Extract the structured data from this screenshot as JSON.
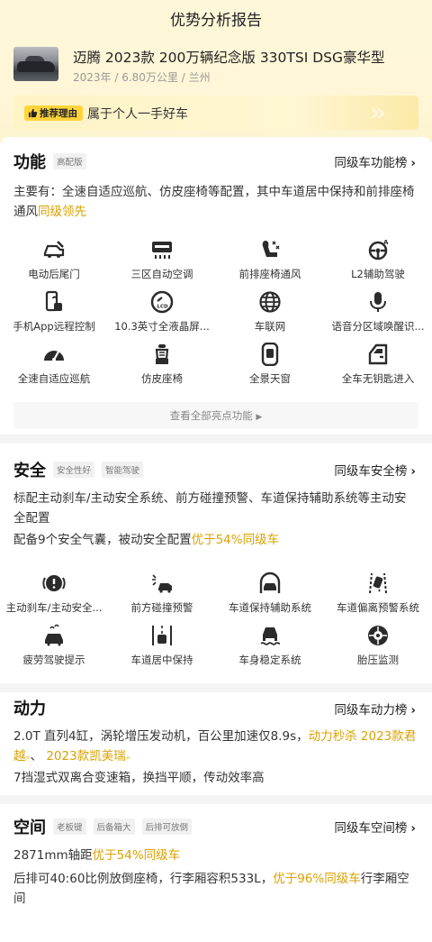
{
  "page_title": "优势分析报告",
  "car": {
    "title": "迈腾 2023款 200万辆纪念版 330TSI DSG豪华型",
    "meta": "2023年 / 6.80万公里 / 兰州"
  },
  "reason": {
    "tag": "推荐理由",
    "text": "属于个人一手好车"
  },
  "function": {
    "title": "功能",
    "pills": [
      "高配版"
    ],
    "rank_link": "同级车功能榜",
    "desc_prefix": "主要有：全速自适应巡航、仿皮座椅等配置，其中车道居中保持和前排座椅通风",
    "desc_highlight": "同级领先",
    "features": [
      {
        "label": "电动后尾门",
        "icon": "power-tailgate-icon"
      },
      {
        "label": "三区自动空调",
        "icon": "climate-control-icon"
      },
      {
        "label": "前排座椅通风",
        "icon": "seat-ventilation-icon"
      },
      {
        "label": "L2辅助驾驶",
        "icon": "l2-assist-icon"
      },
      {
        "label": "手机App远程控制",
        "icon": "phone-remote-icon"
      },
      {
        "label": "10.3英寸全液晶屏...",
        "icon": "lcd-gauge-icon"
      },
      {
        "label": "车联网",
        "icon": "globe-icon"
      },
      {
        "label": "语音分区域唤醒识...",
        "icon": "microphone-icon"
      },
      {
        "label": "全速自适应巡航",
        "icon": "speedometer-icon"
      },
      {
        "label": "仿皮座椅",
        "icon": "seat-icon"
      },
      {
        "label": "全景天窗",
        "icon": "sunroof-icon"
      },
      {
        "label": "全车无钥匙进入",
        "icon": "keyless-door-icon"
      }
    ],
    "view_all": "查看全部亮点功能"
  },
  "safety": {
    "title": "安全",
    "pills": [
      "安全性好",
      "智能驾驶"
    ],
    "rank_link": "同级车安全榜",
    "desc1": "标配主动刹车/主动安全系统、前方碰撞预警、车道保持辅助系统等主动安全配置",
    "desc2_prefix": "配备9个安全气囊，被动安全配置",
    "desc2_highlight": "优于54%同级车",
    "features": [
      {
        "label": "主动刹车/主动安全...",
        "icon": "brake-warning-icon"
      },
      {
        "label": "前方碰撞预警",
        "icon": "collision-warning-icon"
      },
      {
        "label": "车道保持辅助系统",
        "icon": "lane-keep-icon"
      },
      {
        "label": "车道偏离预警系统",
        "icon": "lane-departure-icon"
      },
      {
        "label": "疲劳驾驶提示",
        "icon": "fatigue-alert-icon"
      },
      {
        "label": "车道居中保持",
        "icon": "lane-center-icon"
      },
      {
        "label": "车身稳定系统",
        "icon": "stability-control-icon"
      },
      {
        "label": "胎压监测",
        "icon": "tire-pressure-icon"
      }
    ]
  },
  "power": {
    "title": "动力",
    "rank_link": "同级车动力榜",
    "desc1_prefix": "2.0T 直列4缸，涡轮增压发动机，百公里加速仅8.9s，",
    "desc1_highlight": "动力秒杀 2023款君越",
    "desc1_sep": "、",
    "desc1_highlight2": "2023款凯美瑞",
    "desc2": "7挡湿式双离合变速箱，换挡平顺，传动效率高"
  },
  "space": {
    "title": "空间",
    "pills": [
      "老板键",
      "后备箱大",
      "后排可放倒"
    ],
    "rank_link": "同级车空间榜",
    "desc1_prefix": "2871mm轴距",
    "desc1_highlight": "优于54%同级车",
    "desc2_prefix": "后排可40:60比例放倒座椅，行李厢容积533L，",
    "desc2_highlight": "优于96%同级车",
    "desc2_suffix": "行李厢空间"
  },
  "colors": {
    "accent": "#d9a100",
    "tag_yellow": "#ffd43b",
    "icon_dark": "#2b2b2b"
  }
}
